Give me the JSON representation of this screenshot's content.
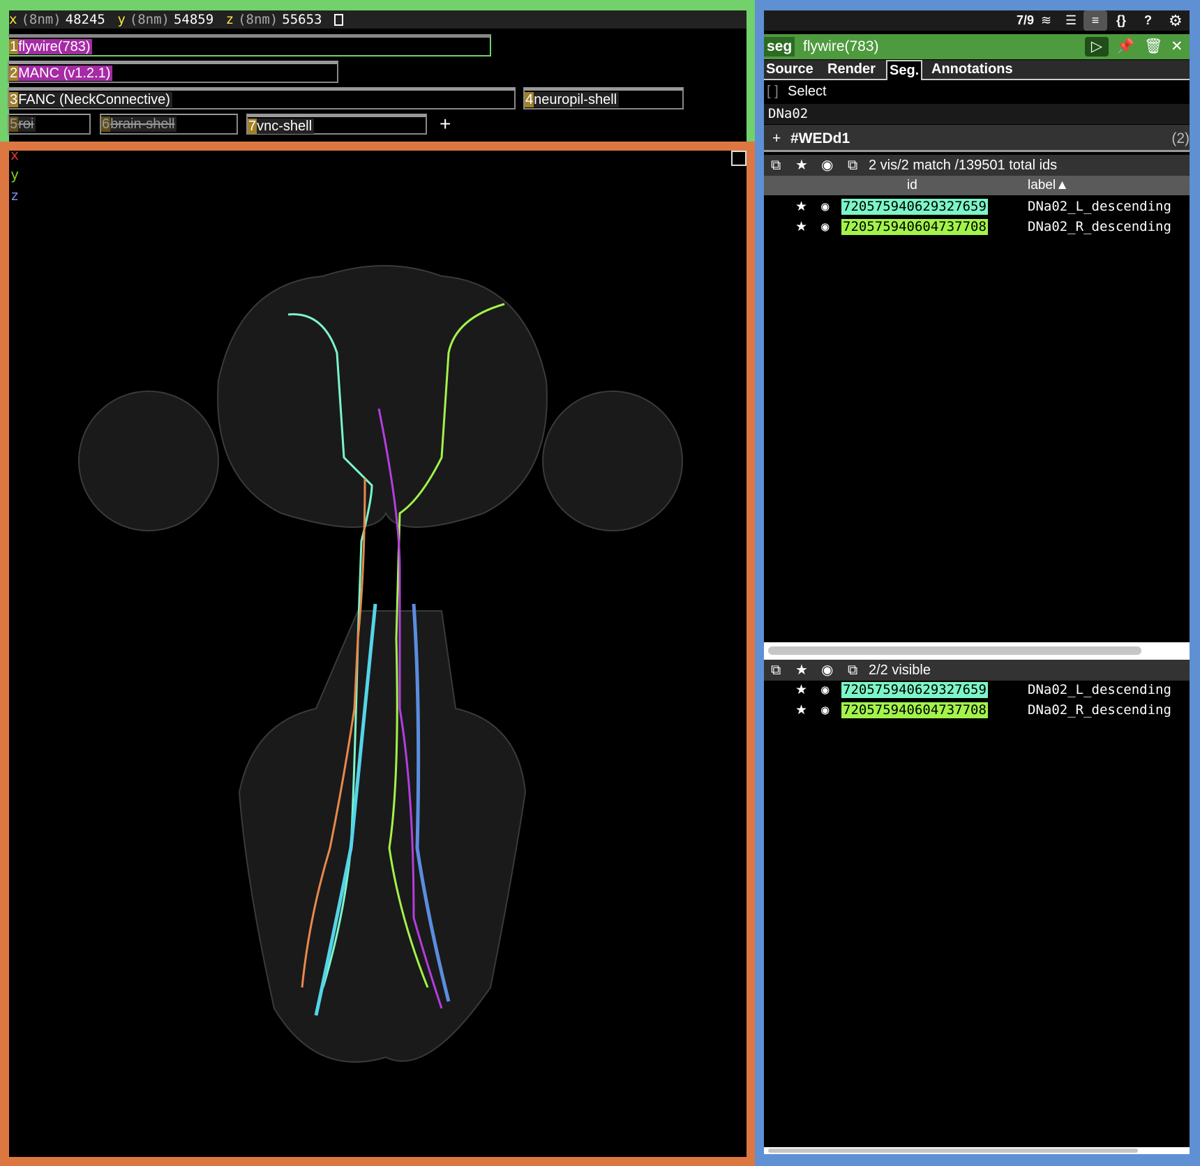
{
  "coords": {
    "x_label": "x",
    "y_label": "y",
    "z_label": "z",
    "unit": "(8nm)",
    "x": "48245",
    "y": "54859",
    "z": "55653"
  },
  "layers": [
    {
      "num": "1",
      "name": "flywire(783)",
      "state": "selected"
    },
    {
      "num": "2",
      "name": "MANC (v1.2.1)",
      "state": "visible"
    },
    {
      "num": "3",
      "name": "FANC (NeckConnective)",
      "state": "visible"
    },
    {
      "num": "4",
      "name": "neuropil-shell",
      "state": "visible"
    },
    {
      "num": "5",
      "name": "roi",
      "state": "hidden"
    },
    {
      "num": "6",
      "name": "brain-shell",
      "state": "hidden"
    },
    {
      "num": "7",
      "name": "vnc-shell",
      "state": "visible"
    }
  ],
  "add_layer": "+",
  "viewer": {
    "axis_x": "x",
    "axis_y": "y",
    "axis_z": "z",
    "colors": {
      "x": "#e53935",
      "y": "#7ed321",
      "z": "#7b8ce8"
    }
  },
  "topbar": {
    "layer_count": "7/9",
    "icons": [
      "layers-icon",
      "list-icon",
      "settings-sliders-icon",
      "json-braces-icon",
      "help-icon",
      "gear-icon"
    ],
    "braces": "{}",
    "help": "?"
  },
  "panel": {
    "type_badge": "seg",
    "layer_name": "flywire(783)",
    "tabs": [
      "Source",
      "Render",
      "Seg.",
      "Annotations"
    ],
    "active_tab": "Seg.",
    "select_bracket": "[  ]",
    "select_label": "Select",
    "query": "DNa02",
    "tag_plus": "+",
    "tag": "#WEDd1",
    "tag_count": "(2)",
    "match_summary": "2 vis/2 match /139501 total ids",
    "col_id": "id",
    "col_label": "label▲",
    "segments": [
      {
        "id": "720575940629327659",
        "label": "DNa02_L_descending",
        "color": "#7cf6c8"
      },
      {
        "id": "720575940604737708",
        "label": "DNa02_R_descending",
        "color": "#a3f34a"
      }
    ],
    "visible_summary": "2/2 visible"
  },
  "frame_colors": {
    "top_left": "#72d16b",
    "viewer": "#dd7742",
    "side_panel": "#5e90d3"
  }
}
